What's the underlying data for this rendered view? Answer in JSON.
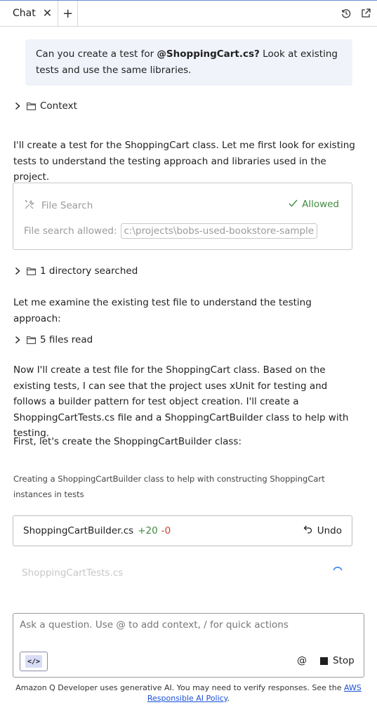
{
  "tabs": {
    "chat_label": "Chat",
    "close_symbol": "✕",
    "add_symbol": "+"
  },
  "icons": {
    "history": "history-icon",
    "open_external": "open-external-icon",
    "tools": "tools-icon",
    "folder": "folder-icon",
    "chevron": "chevron-right-icon"
  },
  "user_message": {
    "before": "Can you create a test for ",
    "mention": "@ShoppingCart.cs?",
    "after": " Look at existing tests and use the same libraries."
  },
  "context_label": "Context",
  "assistant_intro": "I'll create a test for the ShoppingCart class. Let me first look for existing tests to understand the testing approach and libraries used in the project.",
  "tool_card": {
    "title": "File Search",
    "status": "Allowed",
    "field_label": "File search allowed:",
    "field_value": "c:\\projects\\bobs-used-bookstore-sample"
  },
  "directory_summary": "1 directory searched",
  "examine_text": "Let me examine the existing test file to understand the testing approach:",
  "files_read": "5 files read",
  "plan_text": "Now I'll create a test file for the ShoppingCart class. Based on the existing tests, I can see that the project uses xUnit for testing and follows a builder pattern for test object creation. I'll create a ShoppingCartTests.cs file and a ShoppingCartBuilder class to help with testing.",
  "first_text": "First, let's create the ShoppingCartBuilder class:",
  "builder_note": "Creating a ShoppingCartBuilder class to help with constructing ShoppingCart instances in tests",
  "file_change": {
    "name": "ShoppingCartBuilder.cs",
    "added": "+20",
    "removed": "-0",
    "undo_label": "Undo"
  },
  "pending_file": "ShoppingCartTests.cs",
  "composer": {
    "placeholder": "Ask a question. Use @ to add context, / for quick actions",
    "code_label": "</>",
    "at_label": "@",
    "stop_label": "Stop"
  },
  "footer": {
    "text": "Amazon Q Developer uses generative AI. You may need to verify responses. See the ",
    "link": "AWS Responsible AI Policy",
    "end": "."
  },
  "colors": {
    "accent": "#1a4fd8",
    "added": "#3f8a3f",
    "removed": "#c9402f",
    "user_bubble": "#f0f3fa"
  }
}
